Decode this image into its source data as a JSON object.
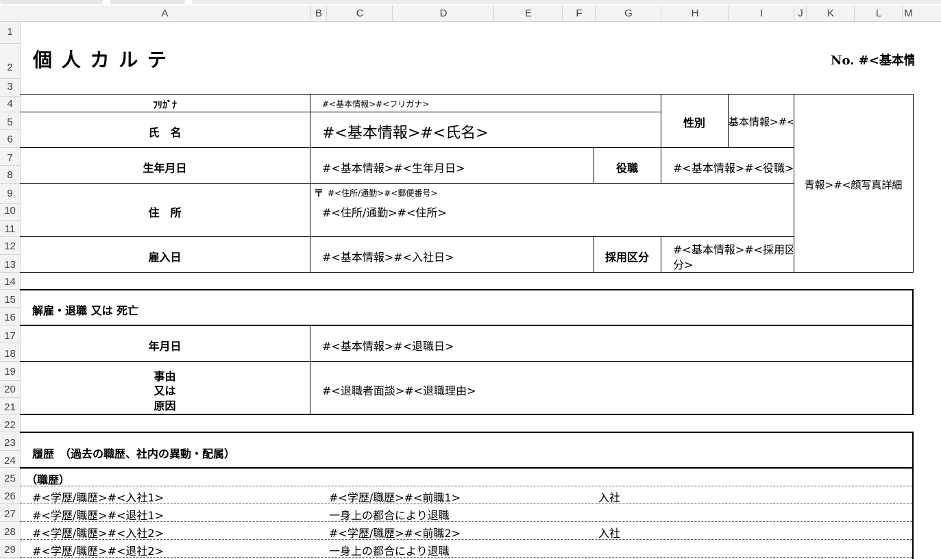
{
  "sheet": {
    "columns": [
      "A",
      "B",
      "C",
      "D",
      "E",
      "F",
      "G",
      "H",
      "I",
      "J",
      "K",
      "L",
      "M"
    ],
    "rows": [
      "1",
      "2",
      "3",
      "4",
      "5",
      "6",
      "7",
      "8",
      "9",
      "10",
      "11",
      "12",
      "13",
      "14",
      "15",
      "16",
      "17",
      "18",
      "19",
      "20",
      "21",
      "22",
      "23",
      "24",
      "25",
      "26",
      "27",
      "28",
      "29"
    ]
  },
  "header": {
    "title": "個 人 カ ル テ",
    "number": "No. #<基本情"
  },
  "basic": {
    "furigana_label": "ﾌﾘｶﾞﾅ",
    "furigana_value": "#<基本情報>#<フリガナ>",
    "name_label": "氏　名",
    "name_value": "#<基本情報>#<氏名>",
    "gender_label": "性別",
    "gender_value": "基本情報>#<性",
    "photo_value": "青報>#<顔写真詳細",
    "birth_label": "生年月日",
    "birth_value": "#<基本情報>#<生年月日>",
    "post_label": "役職",
    "post_value": "#<基本情報>#<役職>",
    "address_label": "住　所",
    "postal_mark": "〒",
    "postal_value": "#<住所/通勤>#<郵便番号>",
    "address_value": "#<住所/通勤>#<住所>",
    "hire_label": "雇入日",
    "hire_value": "#<基本情報>#<入社日>",
    "hire_type_label": "採用区分",
    "hire_type_value_1": "#<基本情報>#<採用区",
    "hire_type_value_2": "分>"
  },
  "retire": {
    "section_title": "解雇・退職 又は 死亡",
    "date_label": "年月日",
    "date_value": "#<基本情報>#<退職日>",
    "reason_label_1": "事由",
    "reason_label_2": "又は",
    "reason_label_3": "原因",
    "reason_value": "#<退職者面談>#<退職理由>"
  },
  "history": {
    "section_title": "履歴　（過去の職歴、社内の異動・配属）",
    "sub_title": "（職歴）",
    "rows": [
      {
        "a": "#<学歴/職歴>#<入社1>",
        "b": "#<学歴/職歴>#<前職1>",
        "c": "入社"
      },
      {
        "a": "#<学歴/職歴>#<退社1>",
        "b": "一身上の都合により退職",
        "c": ""
      },
      {
        "a": "#<学歴/職歴>#<入社2>",
        "b": "#<学歴/職歴>#<前職2>",
        "c": "入社"
      },
      {
        "a": "#<学歴/職歴>#<退社2>",
        "b": "一身上の都合により退職",
        "c": ""
      }
    ]
  }
}
